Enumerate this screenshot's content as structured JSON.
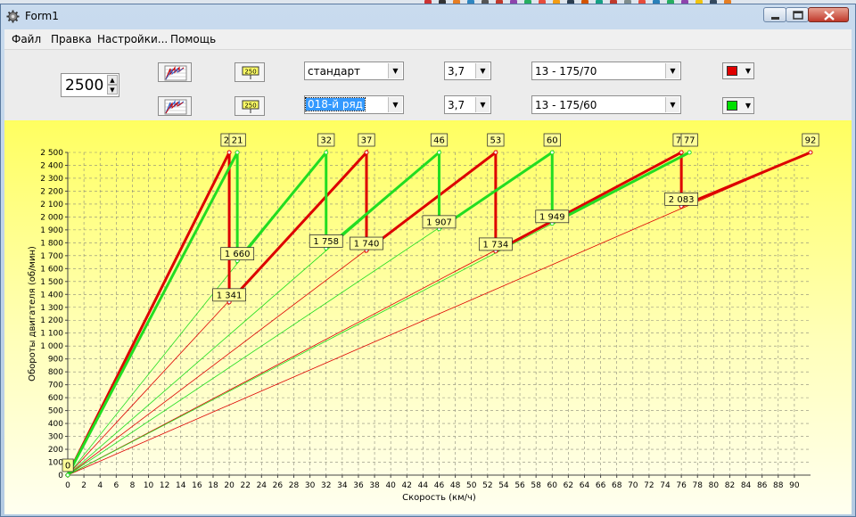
{
  "window": {
    "title": "Form1"
  },
  "menu": {
    "items": [
      "Файл",
      "Правка",
      "Настройки...",
      "Помощь"
    ]
  },
  "toolbar": {
    "rpm_value": "2500",
    "row1": {
      "gearbox": "стандарт",
      "final_drive": "3,7",
      "tire": "13 - 175/70",
      "color": "#e00000"
    },
    "row2": {
      "gearbox": "018-й ряд",
      "final_drive": "3,7",
      "tire": "13 - 175/60",
      "color": "#00e000"
    },
    "graph_icon": "gear-graph-icon",
    "rpm_icon": "rpm-250-icon"
  },
  "chart_data": {
    "type": "line",
    "xlabel": "Скорость (км/ч)",
    "ylabel": "Обороты двигателя (об/мин)",
    "xlim": [
      0,
      92
    ],
    "ylim": [
      0,
      2500
    ],
    "xticks": [
      0,
      2,
      4,
      6,
      8,
      10,
      12,
      14,
      16,
      18,
      20,
      22,
      24,
      26,
      28,
      30,
      32,
      34,
      36,
      38,
      40,
      42,
      44,
      46,
      48,
      50,
      52,
      54,
      56,
      58,
      60,
      62,
      64,
      66,
      68,
      70,
      72,
      74,
      76,
      78,
      80,
      82,
      84,
      86,
      88,
      90
    ],
    "yticks": [
      0,
      100,
      200,
      300,
      400,
      500,
      600,
      700,
      800,
      900,
      1000,
      1100,
      1200,
      1300,
      1400,
      1500,
      1600,
      1700,
      1800,
      1900,
      2000,
      2100,
      2200,
      2300,
      2400,
      2500
    ],
    "ytick_labels": [
      "0",
      "100",
      "200",
      "300",
      "400",
      "500",
      "600",
      "700",
      "800",
      "900",
      "1 000",
      "1 100",
      "1 200",
      "1 300",
      "1 400",
      "1 500",
      "1 600",
      "1 700",
      "1 800",
      "1 900",
      "2 000",
      "2 100",
      "2 200",
      "2 300",
      "2 400",
      "2 500"
    ],
    "grid": true,
    "series": [
      {
        "color": "#dd0000",
        "gear_speeds": [
          20,
          37,
          53,
          76,
          92
        ],
        "shift_rpm": [
          1341,
          1740,
          1734,
          2083
        ],
        "top_labels": [
          "20",
          "37",
          "53",
          "77",
          "92"
        ],
        "shift_labels": [
          "1 341",
          "1 740",
          "1 734",
          "2 083"
        ],
        "path": [
          [
            0,
            0
          ],
          [
            20,
            2500
          ],
          [
            20,
            1341
          ],
          [
            37,
            2500
          ],
          [
            37,
            1740
          ],
          [
            53,
            2500
          ],
          [
            53,
            1734
          ],
          [
            76,
            2500
          ],
          [
            76,
            2083
          ],
          [
            92,
            2500
          ]
        ]
      },
      {
        "color": "#22dd22",
        "gear_speeds": [
          21,
          32,
          46,
          60,
          77
        ],
        "shift_rpm": [
          1660,
          1758,
          1907,
          1949
        ],
        "top_labels": [
          "21",
          "32",
          "46",
          "60",
          "77"
        ],
        "shift_labels": [
          "1 660",
          "1 758",
          "1 907",
          "1 949"
        ],
        "path": [
          [
            0,
            0
          ],
          [
            21,
            2500
          ],
          [
            21,
            1660
          ],
          [
            32,
            2500
          ],
          [
            32,
            1758
          ],
          [
            46,
            2500
          ],
          [
            46,
            1907
          ],
          [
            60,
            2500
          ],
          [
            60,
            1949
          ],
          [
            77,
            2500
          ]
        ]
      }
    ],
    "origin_label": "0"
  }
}
